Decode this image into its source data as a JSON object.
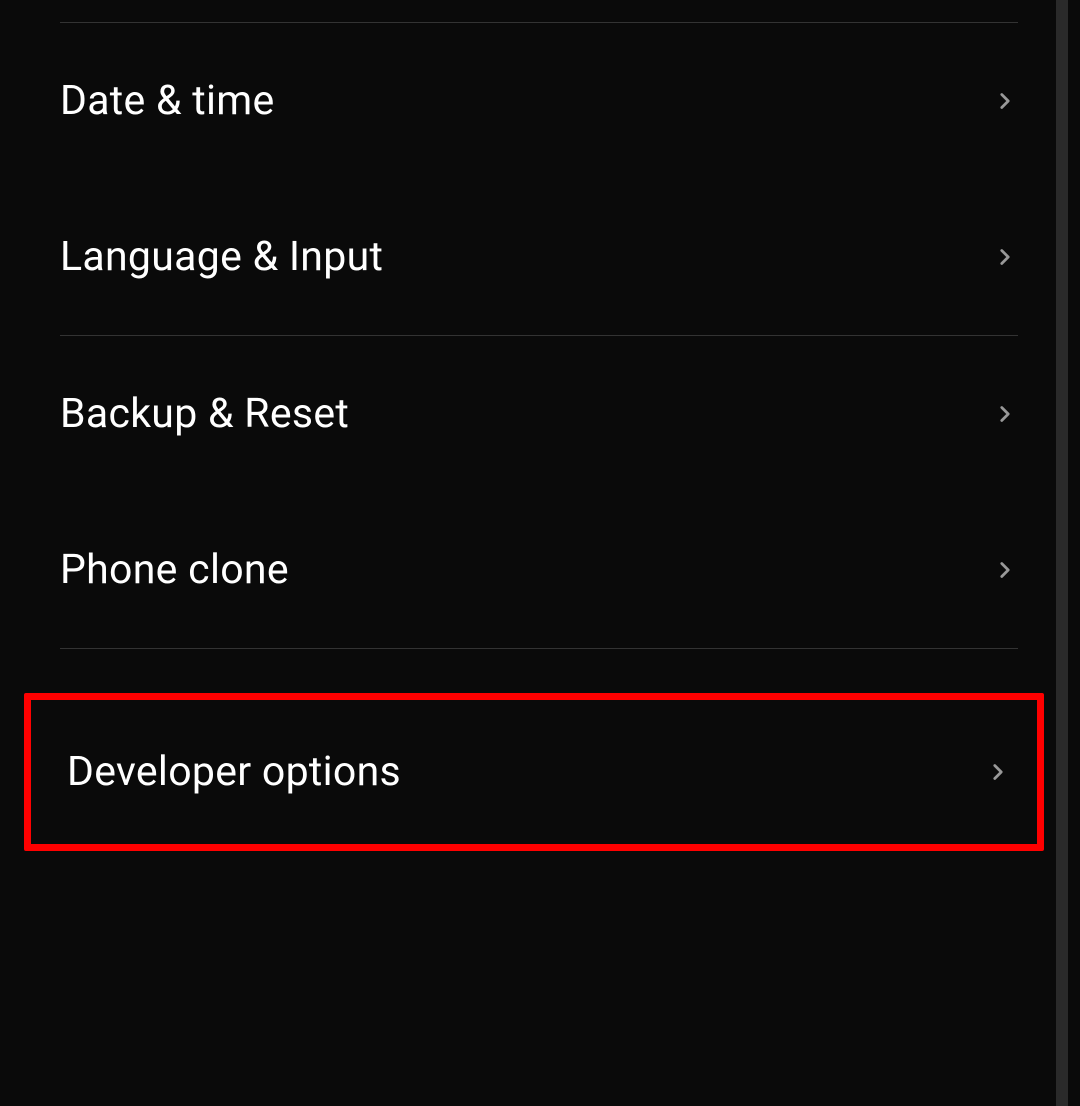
{
  "settings": {
    "items": [
      {
        "label": "Date & time"
      },
      {
        "label": "Language & Input"
      },
      {
        "label": "Backup & Reset"
      },
      {
        "label": "Phone clone"
      },
      {
        "label": "Developer options"
      }
    ]
  }
}
